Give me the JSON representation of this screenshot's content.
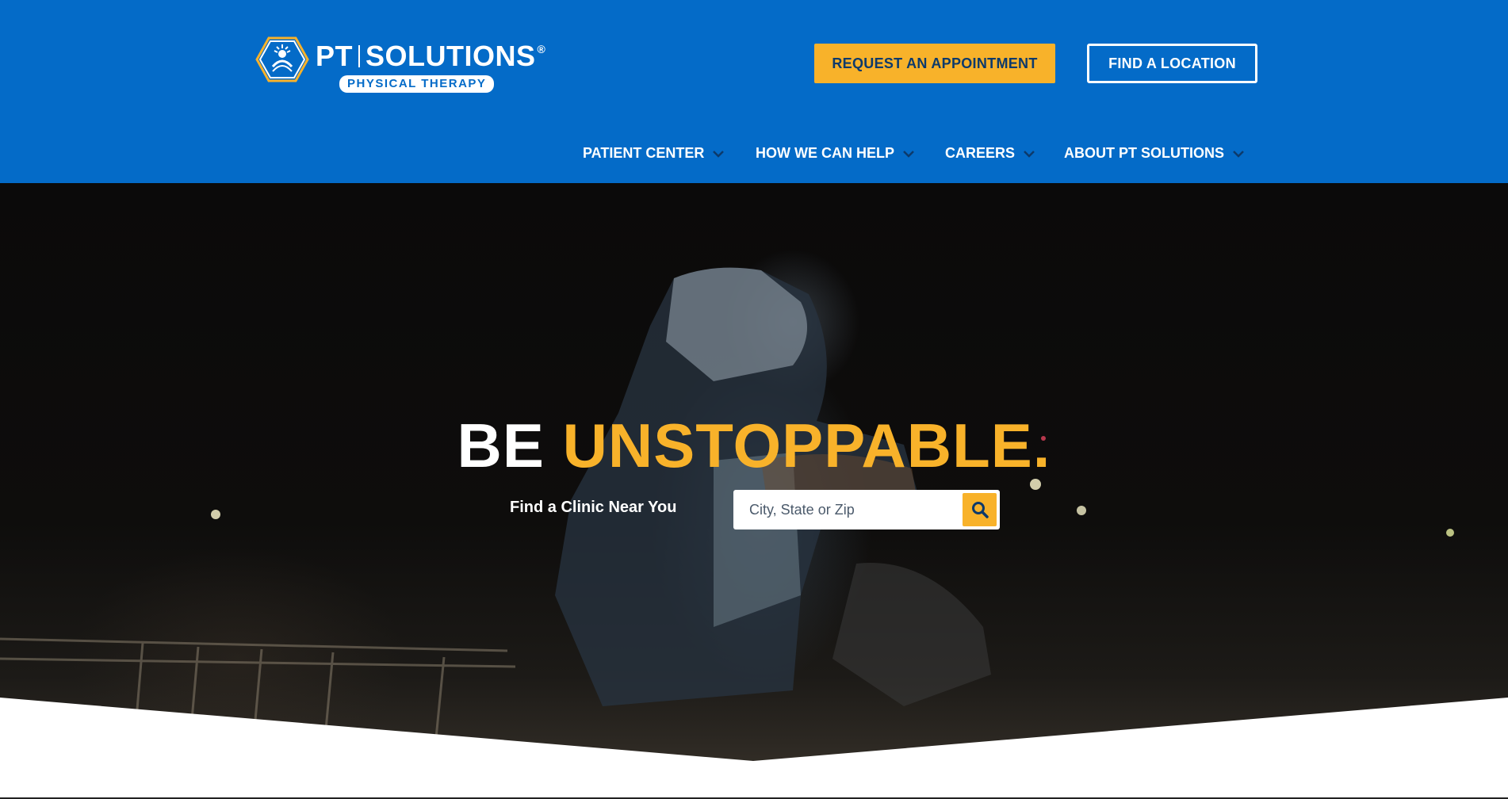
{
  "brand": {
    "name_left": "PT",
    "name_right": "SOLUTIONS",
    "registered_mark": "®",
    "tagline": "PHYSICAL THERAPY"
  },
  "header_buttons": {
    "appointment": "REQUEST AN APPOINTMENT",
    "location": "FIND A LOCATION"
  },
  "nav": {
    "items": [
      {
        "label": "PATIENT CENTER",
        "icon": "chevron-down-icon"
      },
      {
        "label": "HOW WE CAN HELP",
        "icon": "chevron-down-icon"
      },
      {
        "label": "CAREERS",
        "icon": "chevron-down-icon"
      },
      {
        "label": "ABOUT PT SOLUTIONS",
        "icon": "chevron-down-icon"
      }
    ]
  },
  "hero": {
    "headline_white": "BE",
    "headline_yellow": "UNSTOPPABLE.",
    "find_label": "Find a Clinic Near You",
    "search_placeholder": "City, State or Zip",
    "search_icon": "search-icon"
  },
  "colors": {
    "header_blue": "#046bc8",
    "accent_yellow": "#f8b22a",
    "button_text_navy": "#0d3a6b"
  }
}
